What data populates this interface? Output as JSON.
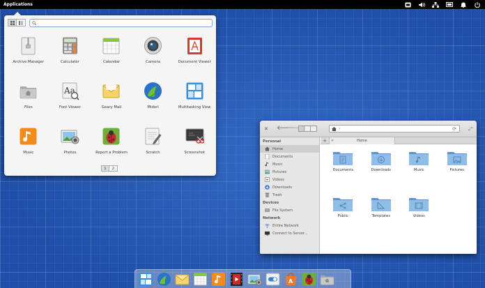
{
  "top_panel": {
    "applications_label": "Applications"
  },
  "launcher": {
    "search": {
      "value": "",
      "placeholder": ""
    },
    "apps": [
      {
        "label": "Archive Manager",
        "icon": "archive-icon"
      },
      {
        "label": "Calculator",
        "icon": "calculator-icon"
      },
      {
        "label": "Calendar",
        "icon": "calendar-icon"
      },
      {
        "label": "Camera",
        "icon": "camera-icon"
      },
      {
        "label": "Document Viewer",
        "icon": "document-viewer-icon"
      },
      {
        "label": "Files",
        "icon": "files-icon"
      },
      {
        "label": "Font Viewer",
        "icon": "font-viewer-icon"
      },
      {
        "label": "Geary Mail",
        "icon": "mail-icon"
      },
      {
        "label": "Midori",
        "icon": "browser-icon"
      },
      {
        "label": "Multitasking View",
        "icon": "multitasking-icon"
      },
      {
        "label": "Music",
        "icon": "music-icon"
      },
      {
        "label": "Photos",
        "icon": "photos-icon"
      },
      {
        "label": "Report a Problem",
        "icon": "bug-icon"
      },
      {
        "label": "Scratch",
        "icon": "text-editor-icon"
      },
      {
        "label": "Screenshot",
        "icon": "screenshot-icon"
      }
    ],
    "pages": [
      "1",
      "2"
    ],
    "active_page": "1"
  },
  "files_window": {
    "tab_title": "Home",
    "sidebar": {
      "personal_heading": "Personal",
      "personal": [
        {
          "label": "Home",
          "icon": "home-icon"
        },
        {
          "label": "Documents",
          "icon": "documents-icon"
        },
        {
          "label": "Music",
          "icon": "music-note-icon"
        },
        {
          "label": "Pictures",
          "icon": "pictures-icon"
        },
        {
          "label": "Videos",
          "icon": "videos-icon"
        },
        {
          "label": "Downloads",
          "icon": "downloads-icon"
        },
        {
          "label": "Trash",
          "icon": "trash-icon"
        }
      ],
      "devices_heading": "Devices",
      "devices": [
        {
          "label": "File System",
          "icon": "drive-icon"
        }
      ],
      "network_heading": "Network",
      "network": [
        {
          "label": "Entire Network",
          "icon": "network-icon"
        },
        {
          "label": "Connect to Server...",
          "icon": "server-icon"
        }
      ]
    },
    "folders": [
      {
        "label": "Documents",
        "emblem": "document"
      },
      {
        "label": "Downloads",
        "emblem": "download"
      },
      {
        "label": "Music",
        "emblem": "music"
      },
      {
        "label": "Pictures",
        "emblem": "picture"
      },
      {
        "label": "Public",
        "emblem": "share"
      },
      {
        "label": "Templates",
        "emblem": "template"
      },
      {
        "label": "Videos",
        "emblem": "video"
      }
    ]
  },
  "dock": {
    "items": [
      "multitasking-icon",
      "browser-icon",
      "mail-icon",
      "calendar-icon",
      "music-icon",
      "video-icon",
      "photos-icon",
      "settings-icon",
      "app-center-icon",
      "bug-icon",
      "files-icon"
    ]
  },
  "colors": {
    "panel": "#000000",
    "desktop": "#1f4fa8",
    "folder": "#7fb2e0",
    "search_border": "#7ea6d8"
  }
}
